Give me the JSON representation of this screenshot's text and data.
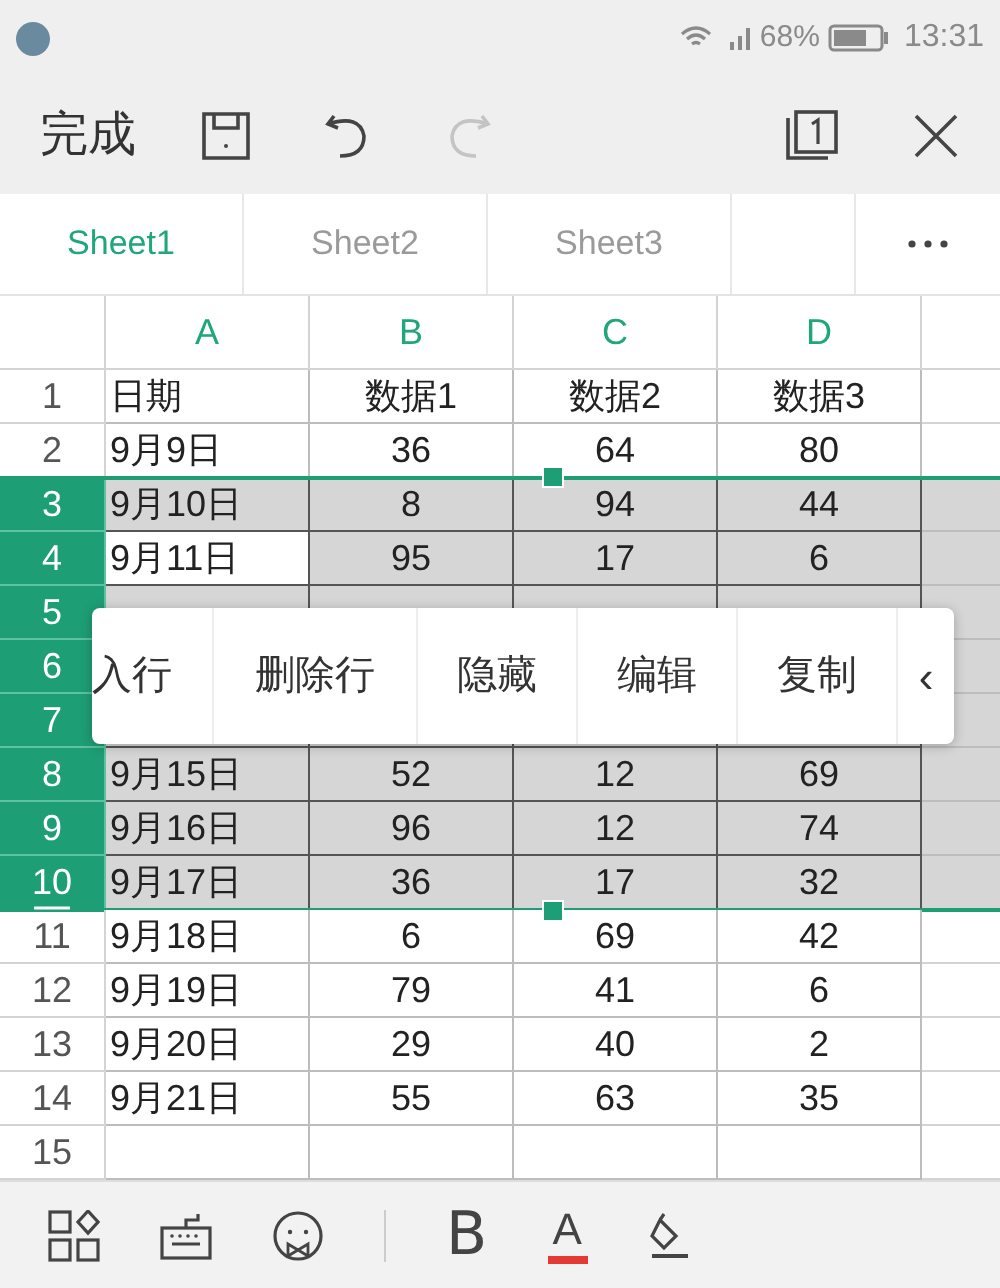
{
  "status_bar": {
    "battery": "68%",
    "time": "13:31"
  },
  "toolbar": {
    "done": "完成",
    "redo_disabled": true
  },
  "tabs": [
    {
      "label": "Sheet1",
      "selected": true
    },
    {
      "label": "Sheet2",
      "selected": false
    },
    {
      "label": "Sheet3",
      "selected": false
    }
  ],
  "columns": [
    "A",
    "B",
    "C",
    "D"
  ],
  "rows": [
    {
      "number": "1",
      "selected": false,
      "cells": [
        "日期",
        "数据1",
        "数据2",
        "数据3"
      ]
    },
    {
      "number": "2",
      "selected": false,
      "cells": [
        "9月9日",
        "36",
        "64",
        "80"
      ]
    },
    {
      "number": "3",
      "selected": true,
      "cells": [
        "9月10日",
        "8",
        "94",
        "44"
      ]
    },
    {
      "number": "4",
      "selected": true,
      "current": true,
      "cells": [
        "9月11日",
        "95",
        "17",
        "6"
      ]
    },
    {
      "number": "5",
      "selected": true
    },
    {
      "number": "6",
      "selected": true
    },
    {
      "number": "7",
      "selected": true
    },
    {
      "number": "8",
      "selected": true,
      "cells": [
        "9月15日",
        "52",
        "12",
        "69"
      ]
    },
    {
      "number": "9",
      "selected": true,
      "cells": [
        "9月16日",
        "96",
        "12",
        "74"
      ]
    },
    {
      "number": "10",
      "selected": true,
      "cells": [
        "9月17日",
        "36",
        "17",
        "32"
      ]
    },
    {
      "number": "11",
      "selected": false,
      "cells": [
        "9月18日",
        "6",
        "69",
        "42"
      ]
    },
    {
      "number": "12",
      "selected": false,
      "cells": [
        "9月19日",
        "79",
        "41",
        "6"
      ]
    },
    {
      "number": "13",
      "selected": false,
      "cells": [
        "9月20日",
        "29",
        "40",
        "2"
      ]
    },
    {
      "number": "14",
      "selected": false,
      "cells": [
        "9月21日",
        "55",
        "63",
        "35"
      ]
    },
    {
      "number": "15",
      "selected": false
    }
  ],
  "context_menu": {
    "items": [
      "入行",
      "删除行",
      "隐藏",
      "编辑",
      "复制"
    ],
    "more": "‹"
  },
  "format_bar": {
    "bold": "B",
    "font_color": "A"
  }
}
